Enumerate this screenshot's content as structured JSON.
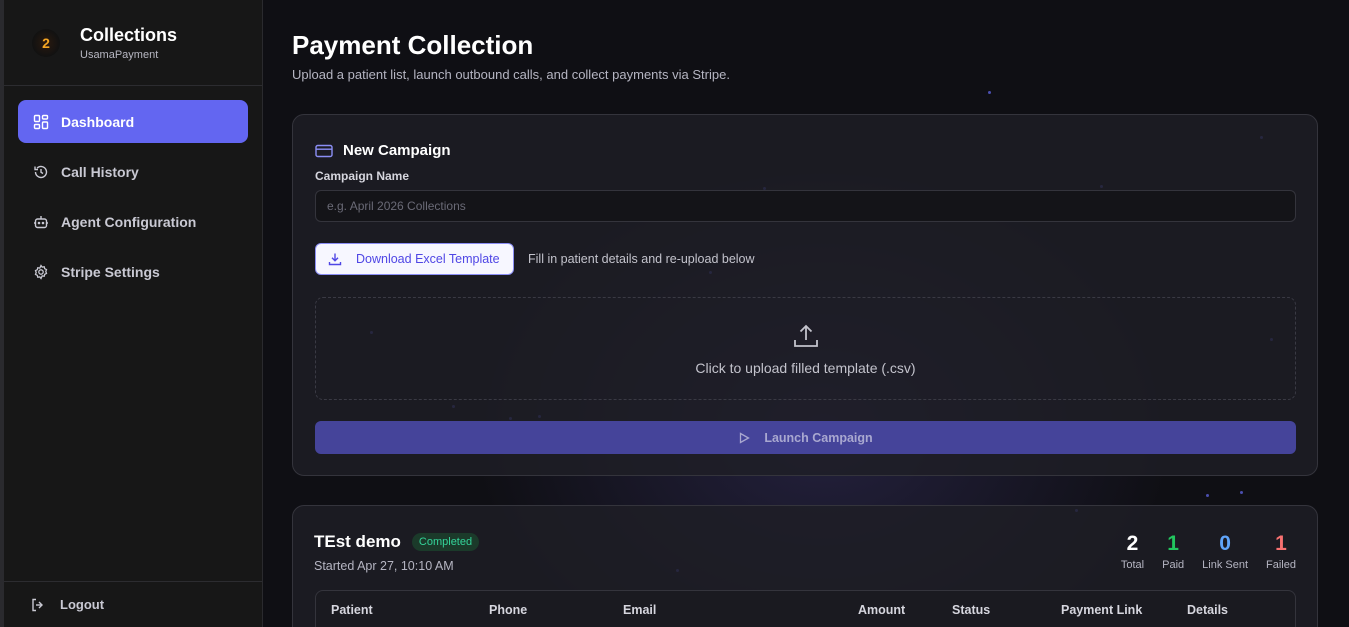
{
  "brand": {
    "title": "Collections",
    "subtitle": "UsamaPayment"
  },
  "sidebar": {
    "items": [
      {
        "label": "Dashboard",
        "icon": "dashboard-icon",
        "active": true
      },
      {
        "label": "Call History",
        "icon": "history-icon",
        "active": false
      },
      {
        "label": "Agent Configuration",
        "icon": "bot-icon",
        "active": false
      },
      {
        "label": "Stripe Settings",
        "icon": "gear-icon",
        "active": false
      }
    ],
    "logout": "Logout"
  },
  "page": {
    "title": "Payment Collection",
    "subtitle": "Upload a patient list, launch outbound calls, and collect payments via Stripe."
  },
  "campaign": {
    "heading": "New Campaign",
    "name_label": "Campaign Name",
    "name_placeholder": "e.g. April 2026 Collections",
    "name_value": "",
    "template_button": "Download Excel Template",
    "template_hint": "Fill in patient details and re-upload below",
    "upload_text": "Click to upload filled template (.csv)",
    "launch_button": "Launch Campaign"
  },
  "demo": {
    "title": "TEst demo",
    "status": "Completed",
    "started": "Started Apr 27, 10:10 AM",
    "stats": [
      {
        "value": "2",
        "label": "Total",
        "color": "#ffffff"
      },
      {
        "value": "1",
        "label": "Paid",
        "color": "#22c55e"
      },
      {
        "value": "0",
        "label": "Link Sent",
        "color": "#60a5fa"
      },
      {
        "value": "1",
        "label": "Failed",
        "color": "#f87171"
      }
    ],
    "columns": [
      "Patient",
      "Phone",
      "Email",
      "Amount",
      "Status",
      "Payment Link",
      "Details"
    ]
  },
  "colors": {
    "accent": "#6366f1",
    "success": "#34d399",
    "background": "#0f0f14"
  }
}
